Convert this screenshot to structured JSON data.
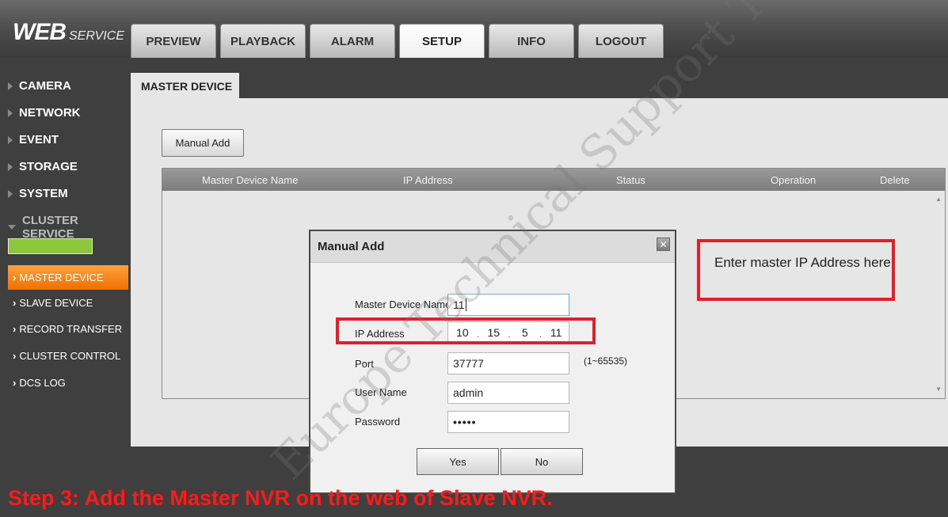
{
  "logo": {
    "main": "WEB",
    "sub": "SERVICE"
  },
  "tabs": [
    "PREVIEW",
    "PLAYBACK",
    "ALARM",
    "SETUP",
    "INFO",
    "LOGOUT"
  ],
  "active_tab": "SETUP",
  "sidebar": {
    "menu": [
      "CAMERA",
      "NETWORK",
      "EVENT",
      "STORAGE",
      "SYSTEM",
      "CLUSTER SERVICE"
    ],
    "submenu": [
      "MASTER DEVICE",
      "SLAVE DEVICE",
      "RECORD TRANSFER",
      "CLUSTER CONTROL",
      "DCS LOG"
    ],
    "active_submenu": "MASTER DEVICE",
    "status_color": "#8cc63f"
  },
  "page": {
    "tab_label": "MASTER DEVICE",
    "manual_add_label": "Manual Add",
    "table_headers": [
      "Master Device Name",
      "IP Address",
      "Status",
      "Operation",
      "Delete"
    ]
  },
  "dialog": {
    "title": "Manual Add",
    "close_glyph": "✕",
    "fields": {
      "name_label": "Master Device Name",
      "name_value": "11",
      "ip_label": "IP Address",
      "ip_segments": [
        "10",
        "15",
        "5",
        "11"
      ],
      "ip_separator": ".",
      "port_label": "Port",
      "port_value": "37777",
      "port_range": "(1~65535)",
      "user_label": "User Name",
      "user_value": "admin",
      "password_label": "Password",
      "password_value": "•••••"
    },
    "yes_label": "Yes",
    "no_label": "No"
  },
  "annotations": {
    "callout": "Enter master IP Address here",
    "step": "Step 3: Add the Master NVR on the web of Slave NVR.",
    "watermark": "Europe Technical Support Team | Gavin",
    "highlight_color": "#e0202a"
  }
}
